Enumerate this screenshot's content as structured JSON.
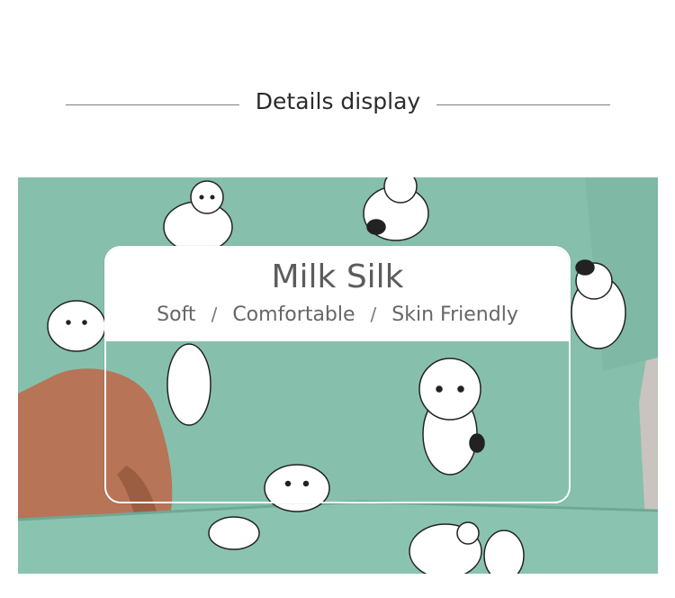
{
  "heading": "Details display",
  "card": {
    "title": "Milk Silk",
    "tags": [
      "Soft",
      "Comfortable",
      "Skin Friendly"
    ],
    "separator": "/"
  },
  "colors": {
    "fabric": "#86c0ad",
    "skin": "#b77456",
    "cat_print": "#ffffff",
    "text_dark": "#2b2b2b",
    "text_gray": "#5c5c5c"
  }
}
